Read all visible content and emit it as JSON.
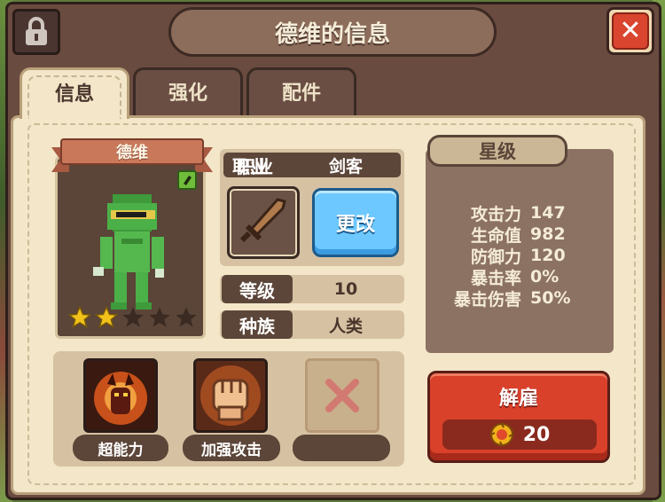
{
  "window": {
    "title": "德维的信息"
  },
  "tabs": [
    {
      "label": "信息",
      "active": true
    },
    {
      "label": "强化",
      "active": false
    },
    {
      "label": "配件",
      "active": false
    }
  ],
  "hero": {
    "name": "德维",
    "stars_filled": 2,
    "stars_total": 5
  },
  "info": {
    "job_label": "职业",
    "job_value": "剑客",
    "change_label": "更改",
    "level_label": "等级",
    "level_value": "10",
    "race_label": "种族",
    "race_value": "人类"
  },
  "skills": [
    {
      "label": "超能力",
      "icon": "demon-power-icon"
    },
    {
      "label": "加强攻击",
      "icon": "fist-icon"
    },
    {
      "label": "",
      "icon": "empty-slot-x-icon"
    }
  ],
  "stats": {
    "header": "星级",
    "rows": [
      {
        "name": "攻击力",
        "value": "147"
      },
      {
        "name": "生命值",
        "value": "982"
      },
      {
        "name": "防御力",
        "value": "120"
      },
      {
        "name": "暴击率",
        "value": "0%"
      },
      {
        "name": "暴击伤害",
        "value": "50%"
      }
    ]
  },
  "dismiss": {
    "label": "解雇",
    "cost": "20",
    "icon": "gold-coin-icon"
  },
  "colors": {
    "panel": "#f3e6c9",
    "frame": "#6a4b3f",
    "accent_blue": "#6dc8ff",
    "accent_red": "#d9412b"
  }
}
